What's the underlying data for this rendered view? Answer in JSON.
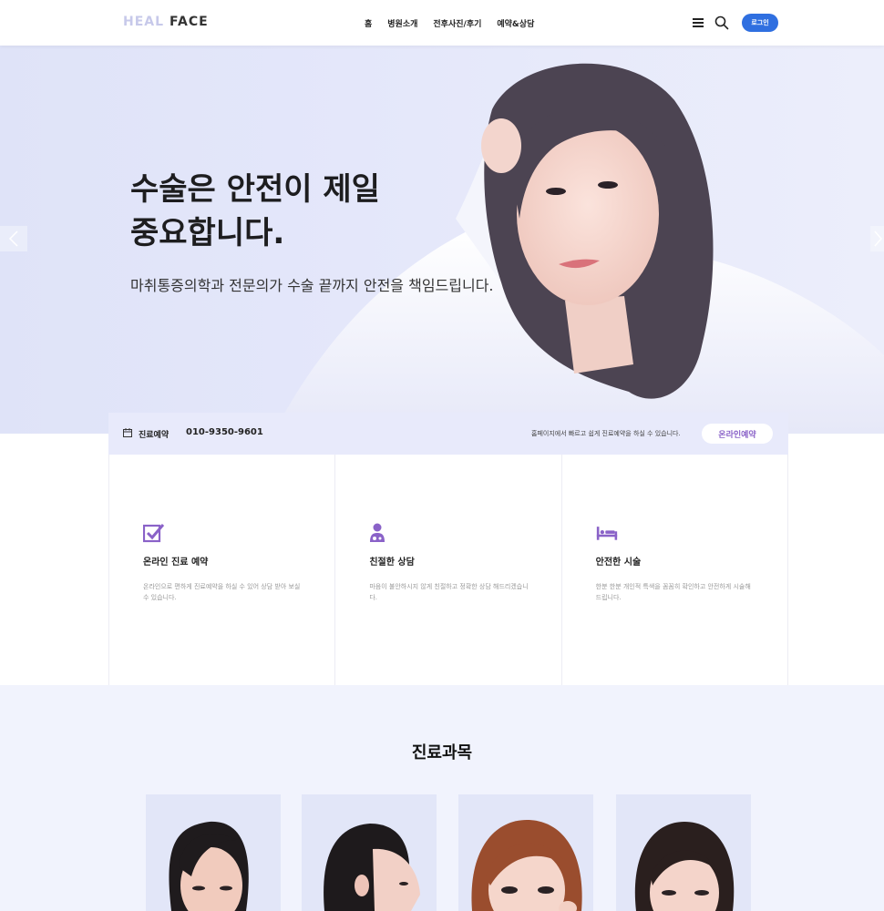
{
  "header": {
    "logo": {
      "part1": "HEAL",
      "part2": "FACE"
    },
    "nav": [
      "홈",
      "병원소개",
      "전후사진/후기",
      "예약&상담"
    ],
    "login_label": "로그인"
  },
  "hero": {
    "title": "수술은 안전이 제일\n중요합니다.",
    "subtitle": "마취통증의학과 전문의가 수술 끝까지 안전을 책임드립니다.",
    "prev_icon": "chevron-left-icon",
    "next_icon": "chevron-right-icon"
  },
  "reservation": {
    "label": "진료예약",
    "phone": "010-9350-9601",
    "note": "홈페이지에서 빠르고 쉽게 진료예약을 하실 수 있습니다.",
    "button_label": "온라인예약"
  },
  "features": [
    {
      "icon": "checkbox-icon",
      "title": "온라인 진료 예약",
      "desc": "온라인으로 편하게 진료예약을 하실 수 있어 상담 받아 보실 수 있습니다."
    },
    {
      "icon": "doctor-icon",
      "title": "친절한 상담",
      "desc": "마음이 불안하시지 않게 친절하고 정확한 상담 해드리겠습니다."
    },
    {
      "icon": "bed-icon",
      "title": "안전한 시술",
      "desc": "한분 한분 개인적 특색을 꼼꼼히 확인하고 안전하게 시술해 드립니다."
    }
  ],
  "departments": {
    "title": "진료과목",
    "cards": [
      {
        "image": "woman-portrait-1"
      },
      {
        "image": "woman-profile-2"
      },
      {
        "image": "woman-portrait-3"
      },
      {
        "image": "woman-portrait-4"
      }
    ]
  },
  "colors": {
    "accent_purple": "#8a62c8",
    "login_blue": "#2f6fe0",
    "hero_bg": "#e2e5f9",
    "section_bg": "#f1f3fd"
  }
}
